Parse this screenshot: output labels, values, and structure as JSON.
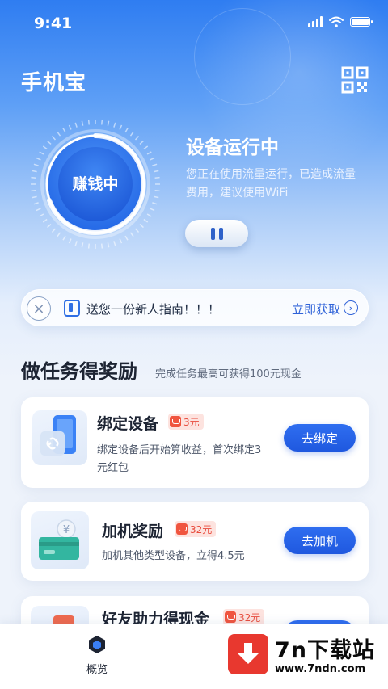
{
  "status_bar": {
    "time": "9:41"
  },
  "header": {
    "title": "手机宝"
  },
  "device": {
    "gauge_label": "赚钱中",
    "status_title": "设备运行中",
    "status_desc": "您正在使用流量运行，已造成流量费用，建议使用WiFi"
  },
  "guide_banner": {
    "text": "送您一份新人指南！！！",
    "cta": "立即获取"
  },
  "tasks_section": {
    "title": "做任务得奖励",
    "subtitle": "完成任务最高可获得100元现金",
    "tasks": [
      {
        "title": "绑定设备",
        "badge": "3元",
        "desc": "绑定设备后开始算收益，首次绑定3元红包",
        "action": "去绑定"
      },
      {
        "title": "加机奖励",
        "badge": "32元",
        "desc": "加机其他类型设备，立得4.5元",
        "action": "去加机"
      },
      {
        "title": "好友助力得现金",
        "badge": "32元",
        "desc": "",
        "action": ""
      }
    ]
  },
  "tabbar": {
    "home_label": "概览"
  },
  "watermark": {
    "name": "7n下载站",
    "url": "www.7ndn.com"
  },
  "colors": {
    "primary": "#1f58df",
    "badge": "#e84b3c",
    "header_gradient_top": "#2f7df1"
  }
}
